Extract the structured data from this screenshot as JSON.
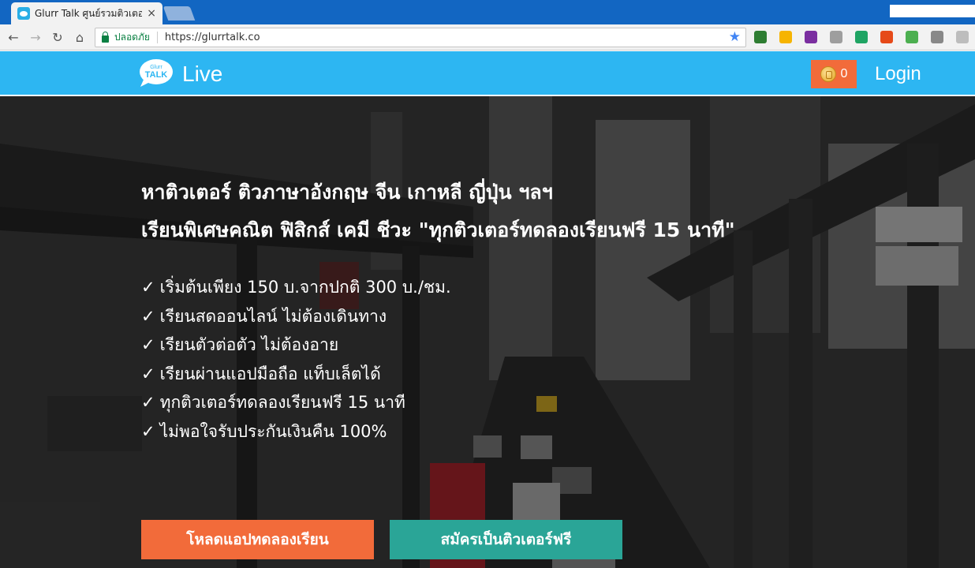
{
  "browser": {
    "tab_title": "Glurr Talk ศูนย์รวมติวเตอร์ติว",
    "tab_close": "×",
    "secure_label": "ปลอดภัย",
    "url": "https://glurrtalk.co",
    "back_icon": "←",
    "forward_icon": "→",
    "reload_icon": "↻",
    "home_icon": "⌂",
    "star_icon": "★",
    "extensions": [
      {
        "name": "globe-icon",
        "color": "#2e7d32"
      },
      {
        "name": "compass-icon",
        "color": "#f6b400"
      },
      {
        "name": "onenote-icon",
        "color": "#7b2fa0"
      },
      {
        "name": "camera-icon",
        "color": "#9e9e9e"
      },
      {
        "name": "drive-icon",
        "color": "#1fa463"
      },
      {
        "name": "office-icon",
        "color": "#e64a19"
      },
      {
        "name": "windows-tiles-icon",
        "color": "#4caf50"
      },
      {
        "name": "person-icon",
        "color": "#888888"
      },
      {
        "name": "folder-icon",
        "color": "#bdbdbd"
      }
    ]
  },
  "header": {
    "logo_text": "Live",
    "coin_count": "0",
    "login_label": "Login",
    "brand_color": "#2db6f2"
  },
  "hero": {
    "headline_line1": "หาติวเตอร์ ติวภาษาอังกฤษ จีน เกาหลี ญี่ปุ่น ฯลฯ",
    "headline_line2": "เรียนพิเศษคณิต ฟิสิกส์ เคมี ชีวะ \"ทุกติวเตอร์ทดลองเรียนฟรี 15 นาที\"",
    "check_mark": "✓",
    "features": [
      "เริ่มต้นเพียง 150 บ.จากปกติ 300 บ./ชม.",
      "เรียนสดออนไลน์ ไม่ต้องเดินทาง",
      "เรียนตัวต่อตัว ไม่ต้องอาย",
      "เรียนผ่านแอปมือถือ แท็บเล็ตได้",
      "ทุกติวเตอร์ทดลองเรียนฟรี 15 นาที",
      "ไม่พอใจรับประกันเงินคืน 100%"
    ],
    "cta_app_label": "โหลดแอปทดลองเรียน",
    "cta_tutor_label": "สมัครเป็นติวเตอร์ฟรี",
    "cta_app_color": "#f26b3a",
    "cta_tutor_color": "#2aa597"
  }
}
